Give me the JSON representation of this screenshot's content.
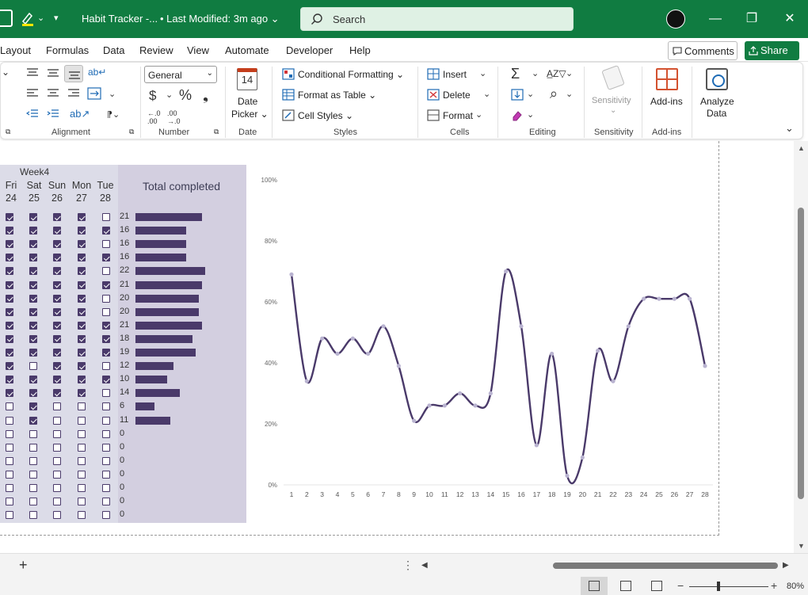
{
  "titlebar": {
    "title": "Habit Tracker -...",
    "modified": "• Last Modified: 3m ago ⌄",
    "search_placeholder": "Search",
    "quick_caret": "⌄",
    "quick_more": "▾",
    "minimize": "—",
    "restore": "❐",
    "close": "✕"
  },
  "menu": {
    "items": [
      "Layout",
      "Formulas",
      "Data",
      "Review",
      "View",
      "Automate",
      "Developer",
      "Help"
    ],
    "comments": "Comments",
    "share": "Share ⌄"
  },
  "ribbon": {
    "groups": [
      "Alignment",
      "Number",
      "Date",
      "Styles",
      "Cells",
      "Editing",
      "Sensitivity",
      "Add-ins"
    ],
    "number_format": "General",
    "date_picker_1": "Date",
    "date_picker_2": "Picker ⌄",
    "calendar_day": "14",
    "conditional_formatting": "Conditional Formatting ⌄",
    "format_as_table": "Format as Table ⌄",
    "cell_styles": "Cell Styles ⌄",
    "insert": "Insert",
    "delete": "Delete",
    "format": "Format",
    "sensitivity": "Sensitivity",
    "addins": "Add-ins",
    "analyze_1": "Analyze",
    "analyze_2": "Data",
    "dollar": "$",
    "percent": "%",
    "comma": "❟",
    "inc_dec": "←.0 .00",
    "dec_dec": ".00 →.0",
    "sigma": "Σ",
    "sort": "A̲Z▽",
    "find": "⌕",
    "colors": {
      "excel_green": "#107c41",
      "accent_purple": "#4a3a6a",
      "chart_point": "#b9b3d0"
    }
  },
  "tracker": {
    "week_title": "Week4",
    "days": [
      {
        "name": "Fri",
        "num": "24"
      },
      {
        "name": "Sat",
        "num": "25"
      },
      {
        "name": "Sun",
        "num": "26"
      },
      {
        "name": "Mon",
        "num": "27"
      },
      {
        "name": "Tue",
        "num": "28"
      }
    ],
    "total_title": "Total completed",
    "rows": [
      {
        "checks": [
          1,
          1,
          1,
          1,
          0
        ],
        "total": 21
      },
      {
        "checks": [
          1,
          1,
          1,
          1,
          1
        ],
        "total": 16
      },
      {
        "checks": [
          1,
          1,
          1,
          1,
          0
        ],
        "total": 16
      },
      {
        "checks": [
          1,
          1,
          1,
          1,
          1
        ],
        "total": 16
      },
      {
        "checks": [
          1,
          1,
          1,
          1,
          0
        ],
        "total": 22
      },
      {
        "checks": [
          1,
          1,
          1,
          1,
          1
        ],
        "total": 21
      },
      {
        "checks": [
          1,
          1,
          1,
          1,
          0
        ],
        "total": 20
      },
      {
        "checks": [
          1,
          1,
          1,
          1,
          0
        ],
        "total": 20
      },
      {
        "checks": [
          1,
          1,
          1,
          1,
          1
        ],
        "total": 21
      },
      {
        "checks": [
          1,
          1,
          1,
          1,
          1
        ],
        "total": 18
      },
      {
        "checks": [
          1,
          1,
          1,
          1,
          1
        ],
        "total": 19
      },
      {
        "checks": [
          1,
          0,
          1,
          1,
          0
        ],
        "total": 12
      },
      {
        "checks": [
          1,
          1,
          1,
          1,
          1
        ],
        "total": 10
      },
      {
        "checks": [
          1,
          1,
          1,
          1,
          0
        ],
        "total": 14
      },
      {
        "checks": [
          0,
          1,
          0,
          0,
          0
        ],
        "total": 6
      },
      {
        "checks": [
          0,
          1,
          0,
          0,
          0
        ],
        "total": 11
      },
      {
        "checks": [
          0,
          0,
          0,
          0,
          0
        ],
        "total": 0
      },
      {
        "checks": [
          0,
          0,
          0,
          0,
          0
        ],
        "total": 0
      },
      {
        "checks": [
          0,
          0,
          0,
          0,
          0
        ],
        "total": 0
      },
      {
        "checks": [
          0,
          0,
          0,
          0,
          0
        ],
        "total": 0
      },
      {
        "checks": [
          0,
          0,
          0,
          0,
          0
        ],
        "total": 0
      },
      {
        "checks": [
          0,
          0,
          0,
          0,
          0
        ],
        "total": 0
      },
      {
        "checks": [
          0,
          0,
          0,
          0,
          0
        ],
        "total": 0
      }
    ],
    "bar_max": 22
  },
  "chart_data": {
    "type": "line",
    "x": [
      1,
      2,
      3,
      4,
      5,
      6,
      7,
      8,
      9,
      10,
      11,
      12,
      13,
      14,
      15,
      16,
      17,
      18,
      19,
      20,
      21,
      22,
      23,
      24,
      25,
      26,
      27,
      28
    ],
    "values": [
      69,
      34,
      48,
      43,
      48,
      43,
      52,
      39,
      21,
      26,
      26,
      30,
      26,
      30,
      70,
      52,
      13,
      43,
      3,
      9,
      44,
      34,
      52,
      61,
      61,
      61,
      61,
      39
    ],
    "y_ticks": [
      "0%",
      "20%",
      "40%",
      "60%",
      "80%",
      "100%"
    ],
    "ylim": [
      0,
      100
    ],
    "smooth": true,
    "line_color": "#4a3a6a",
    "point_color": "#b9b3d0",
    "grid": false
  },
  "tabbar": {
    "add": "+",
    "dots": "⋮",
    "left": "◀",
    "right": "▶"
  },
  "statusbar": {
    "zoom": "80%",
    "minus": "−",
    "plus": "+"
  }
}
